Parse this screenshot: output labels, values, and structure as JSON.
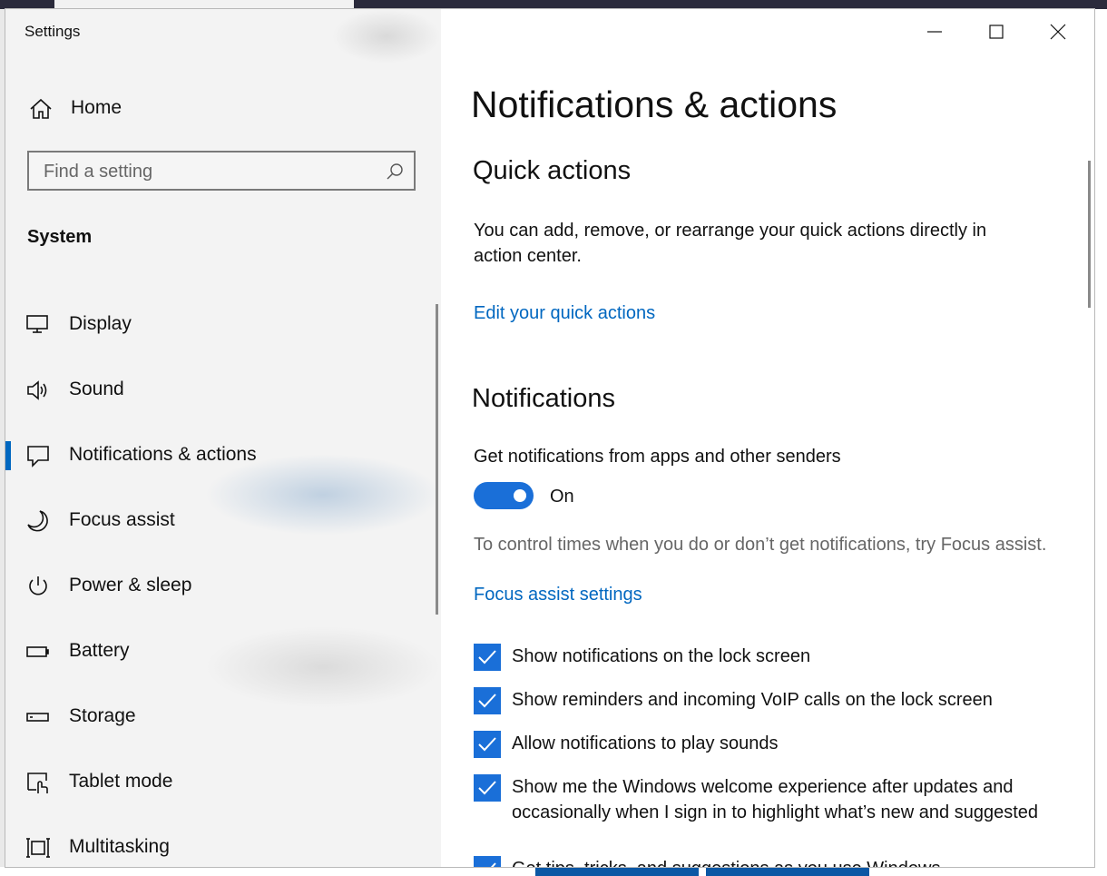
{
  "window": {
    "title": "Settings"
  },
  "sidebar": {
    "home_label": "Home",
    "search_placeholder": "Find a setting",
    "section_label": "System",
    "items": [
      {
        "label": "Display",
        "icon": "display-icon"
      },
      {
        "label": "Sound",
        "icon": "speaker-icon"
      },
      {
        "label": "Notifications & actions",
        "icon": "notifications-icon",
        "selected": true
      },
      {
        "label": "Focus assist",
        "icon": "moon-icon"
      },
      {
        "label": "Power & sleep",
        "icon": "power-icon"
      },
      {
        "label": "Battery",
        "icon": "battery-icon"
      },
      {
        "label": "Storage",
        "icon": "storage-icon"
      },
      {
        "label": "Tablet mode",
        "icon": "tablet-mode-icon"
      },
      {
        "label": "Multitasking",
        "icon": "multitasking-icon"
      }
    ]
  },
  "main": {
    "title": "Notifications & actions",
    "quick_actions": {
      "heading": "Quick actions",
      "description": "You can add, remove, or rearrange your quick actions directly in action center.",
      "link": "Edit your quick actions"
    },
    "notifications": {
      "heading": "Notifications",
      "toggle_caption": "Get notifications from apps and other senders",
      "toggle_state": "On",
      "focus_text": "To control times when you do or don’t get notifications, try Focus assist.",
      "focus_link": "Focus assist settings",
      "checkboxes": [
        {
          "label": "Show notifications on the lock screen",
          "checked": true
        },
        {
          "label": "Show reminders and incoming VoIP calls on the lock screen",
          "checked": true
        },
        {
          "label": "Allow notifications to play sounds",
          "checked": true
        },
        {
          "label": "Show me the Windows welcome experience after updates and occasionally when I sign in to highlight what’s new and suggested",
          "checked": true
        },
        {
          "label": "Get tips, tricks, and suggestions as you use Windows",
          "checked": true
        }
      ]
    }
  },
  "colors": {
    "accent": "#0067c0",
    "toggle_on": "#1a6fd8",
    "sidebar_bg": "#f3f3f3"
  }
}
